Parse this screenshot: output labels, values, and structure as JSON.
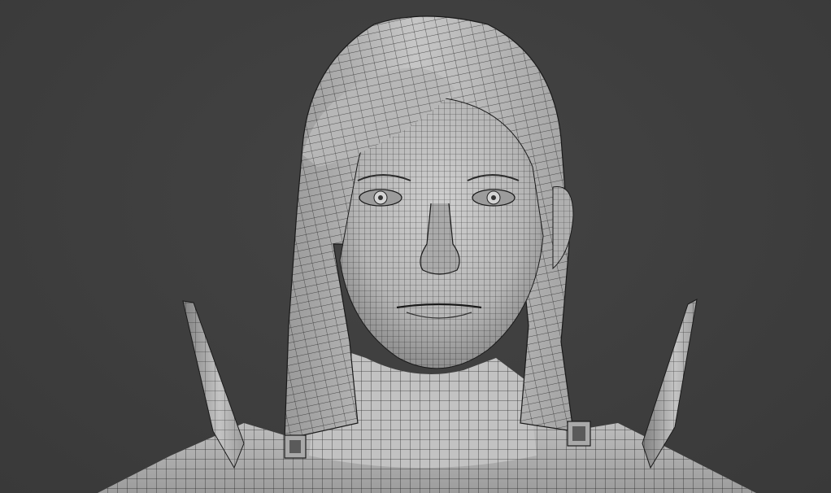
{
  "viewport": {
    "background_color": "#3d3d3d",
    "mesh_fill_color": "#b9b9b9",
    "mesh_shadow_color": "#8a8a8a",
    "wire_color": "#1a1a1a",
    "subject": "wireframe-character-bust"
  }
}
